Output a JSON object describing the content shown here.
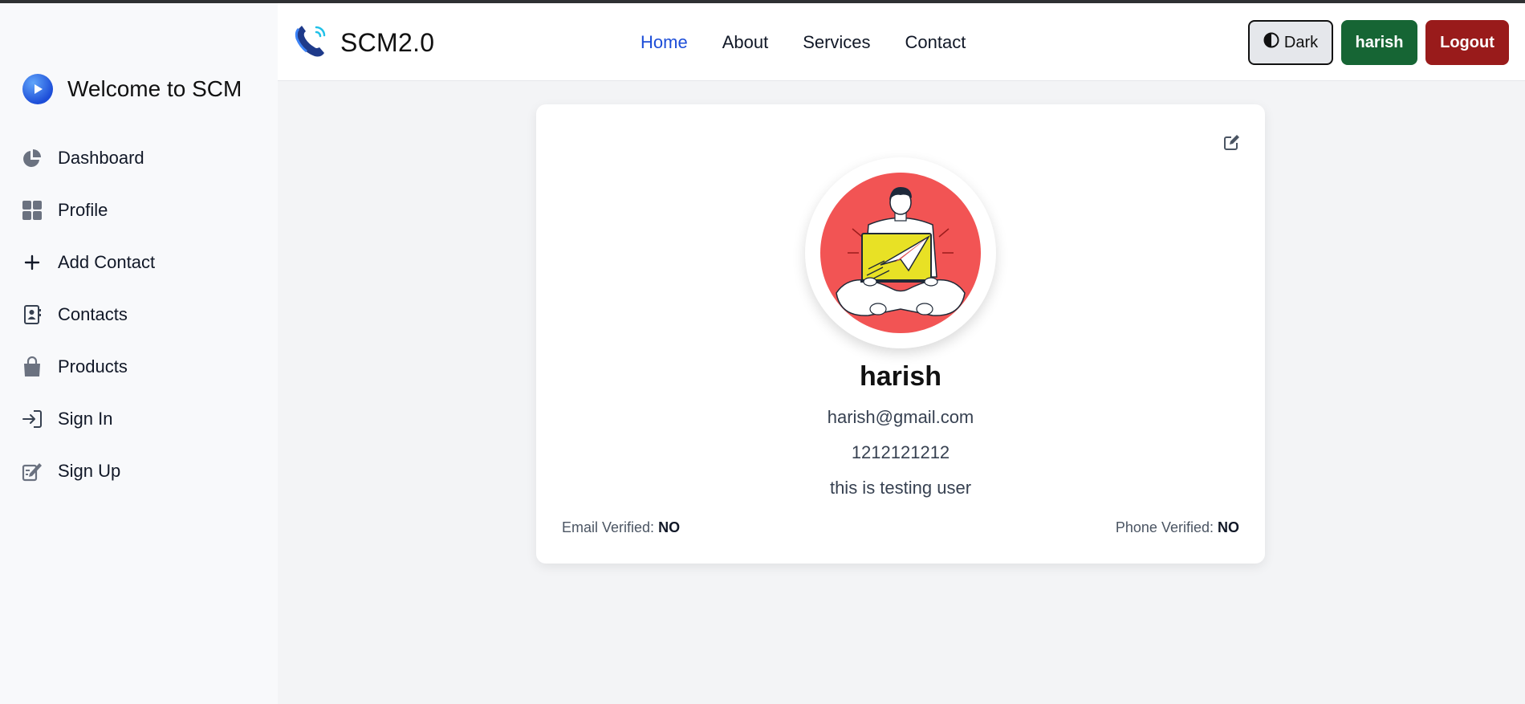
{
  "sidebar": {
    "brand_title": "Welcome to SCM",
    "items": [
      {
        "label": "Dashboard",
        "icon": "pie-chart-icon"
      },
      {
        "label": "Profile",
        "icon": "grid-icon"
      },
      {
        "label": "Add Contact",
        "icon": "plus-icon"
      },
      {
        "label": "Contacts",
        "icon": "address-book-icon"
      },
      {
        "label": "Products",
        "icon": "shopping-bag-icon"
      },
      {
        "label": "Sign In",
        "icon": "sign-in-icon"
      },
      {
        "label": "Sign Up",
        "icon": "sign-up-icon"
      }
    ]
  },
  "header": {
    "logo_title": "SCM2.0",
    "nav": [
      {
        "label": "Home",
        "active": true
      },
      {
        "label": "About"
      },
      {
        "label": "Services"
      },
      {
        "label": "Contact"
      }
    ],
    "dark_label": "Dark",
    "user_label": "harish",
    "logout_label": "Logout"
  },
  "profile": {
    "name": "harish",
    "email": "harish@gmail.com",
    "phone": "1212121212",
    "about": "this is testing user",
    "email_verified_label": "Email Verified:",
    "email_verified_value": "NO",
    "phone_verified_label": "Phone Verified:",
    "phone_verified_value": "NO"
  },
  "colors": {
    "accent": "#1d4ed8",
    "user_button": "#166534",
    "logout_button": "#991b1b",
    "avatar_bg": "#f25454"
  }
}
